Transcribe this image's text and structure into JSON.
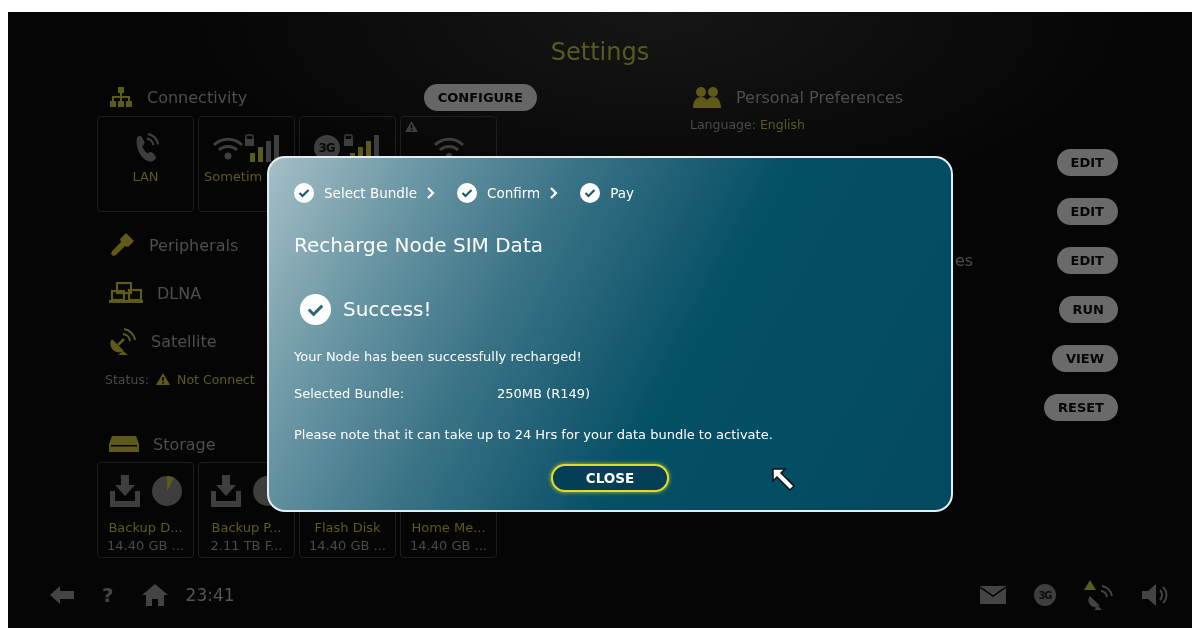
{
  "screen_title": "Settings",
  "connectivity": {
    "title": "Connectivity",
    "button": "CONFIGURE",
    "tiles": [
      {
        "kind": "lan",
        "label": "LAN"
      },
      {
        "kind": "wifi",
        "label": "Sometim"
      },
      {
        "kind": "cellular",
        "badge": "3G"
      },
      {
        "kind": "wifi_warning"
      }
    ]
  },
  "sections": [
    {
      "kind": "peripherals",
      "label": "Peripherals"
    },
    {
      "kind": "dlna",
      "label": "DLNA"
    },
    {
      "kind": "satellite",
      "label": "Satellite"
    }
  ],
  "satellite_status": {
    "label": "Status:",
    "value": "Not Connect"
  },
  "storage": {
    "title": "Storage",
    "devices": [
      {
        "kind": "icons",
        "name": "Backup D...",
        "size": "14.40 GB ..."
      },
      {
        "kind": "icons",
        "name": "Backup P...",
        "size": "2.11 TB F..."
      },
      {
        "kind": "text",
        "name": "Flash Disk",
        "size": "14.40 GB ..."
      },
      {
        "kind": "text",
        "name": "Home Me...",
        "size": "14.40 GB ..."
      }
    ]
  },
  "preferences": {
    "title": "Personal Preferences",
    "language_label": "Language:",
    "language_value": "English",
    "rows": [
      {
        "button": "EDIT"
      },
      {
        "button": "EDIT"
      },
      {
        "fragment": "es",
        "button": "EDIT"
      },
      {
        "button": "RUN"
      },
      {
        "button": "VIEW"
      },
      {
        "button": "RESET"
      }
    ]
  },
  "status_bar": {
    "help": "?",
    "time": "23:41",
    "network_badge": "3G"
  },
  "dialog": {
    "steps": [
      {
        "label": "Select Bundle",
        "done": true
      },
      {
        "label": "Confirm",
        "done": true
      },
      {
        "label": "Pay",
        "done": true
      }
    ],
    "title": "Recharge Node SIM Data",
    "result": "Success!",
    "message": "Your Node has been successfully recharged!",
    "bundle_label": "Selected Bundle:",
    "bundle_value": "250MB (R149)",
    "note": "Please note that it can take up to 24 Hrs for your data bundle to activate.",
    "button": "CLOSE"
  }
}
